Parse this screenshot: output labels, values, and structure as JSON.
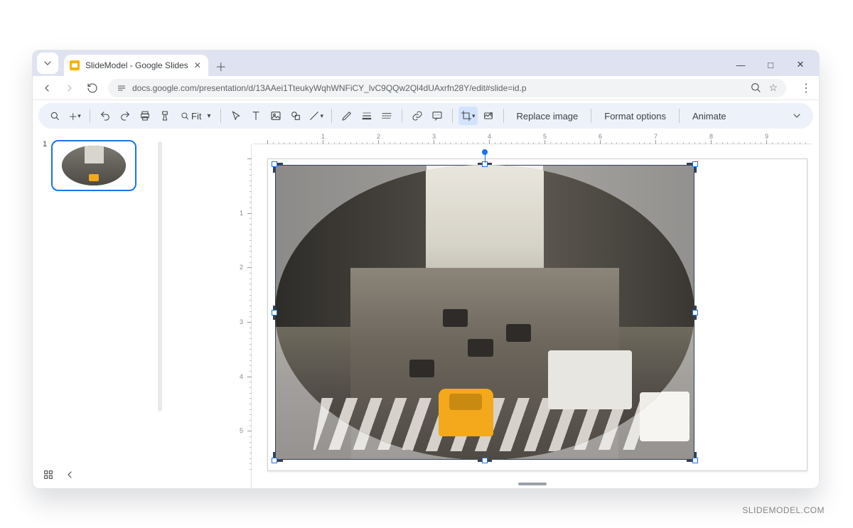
{
  "browser": {
    "tab_title": "SlideModel - Google Slides",
    "url": "docs.google.com/presentation/d/13AAei1TteukyWqhWNFiCY_lvC9QQw2Ql4dUAxrfn28Y/edit#slide=id.p"
  },
  "toolbar": {
    "zoom_label": "Fit",
    "replace_image": "Replace image",
    "format_options": "Format options",
    "animate": "Animate"
  },
  "ruler": {
    "h": [
      "1",
      "2",
      "3",
      "4",
      "5",
      "6",
      "7",
      "8",
      "9"
    ],
    "v": [
      "1",
      "2",
      "3",
      "4",
      "5"
    ]
  },
  "slides": {
    "current_number": "1"
  },
  "watermark": "SLIDEMODEL.COM"
}
